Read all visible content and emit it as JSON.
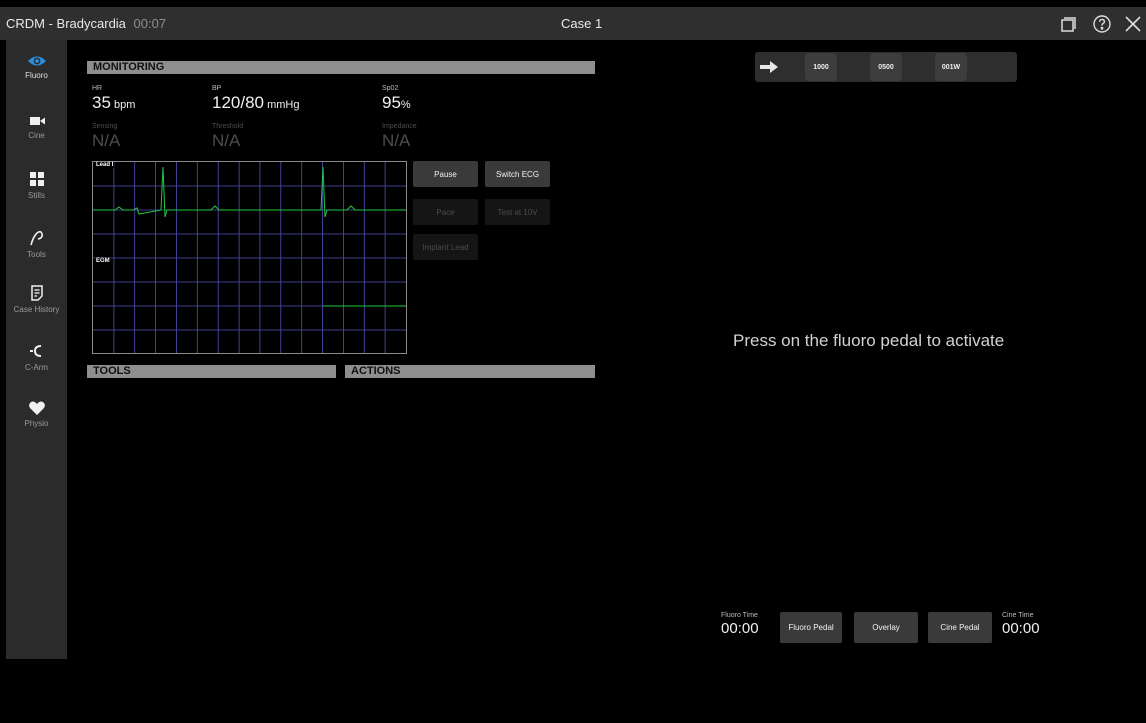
{
  "titlebar": {
    "app_title": "CRDM - Bradycardia",
    "elapsed": "00:07",
    "case_title": "Case 1",
    "icons": [
      "window-restore-icon",
      "help-icon",
      "close-icon"
    ]
  },
  "sidebar": {
    "items": [
      {
        "label": "Fluoro",
        "icon": "eye-icon",
        "active": true
      },
      {
        "label": "Cine",
        "icon": "video-camera-icon"
      },
      {
        "label": "Stills",
        "icon": "grid-icon"
      },
      {
        "label": "Tools",
        "icon": "lasso-icon"
      },
      {
        "label": "Case History",
        "icon": "notes-icon"
      },
      {
        "label": "C-Arm",
        "icon": "c-arm-icon"
      },
      {
        "label": "Physio",
        "icon": "heart-icon"
      }
    ]
  },
  "monitoring": {
    "header": "MONITORING",
    "vitals": {
      "hr": {
        "label": "HR",
        "value": "35",
        "unit": "bpm"
      },
      "bp": {
        "label": "BP",
        "value": "120/80",
        "unit": "mmHg"
      },
      "spo2": {
        "label": "Sp02",
        "value": "95",
        "unit": "%"
      },
      "sensing": {
        "label": "Sensing",
        "value": "N/A"
      },
      "threshold": {
        "label": "Threshold",
        "value": "N/A"
      },
      "impedance": {
        "label": "Impedance",
        "value": "N/A"
      }
    },
    "ecg": {
      "lead_label": "Lead I",
      "egm_label": "EGM",
      "colors": {
        "grid": "#5a5ad0",
        "trace": "#22c840"
      }
    },
    "buttons": {
      "pause": "Pause",
      "switch_ecg": "Switch ECG",
      "pace": "Pace",
      "test": "Test at 10V",
      "implant_lead": "Implant Lead"
    }
  },
  "tools": {
    "header": "TOOLS"
  },
  "actions": {
    "header": "ACTIONS"
  },
  "pacer_bar": {
    "values": [
      "1000",
      "0500",
      "001W"
    ]
  },
  "fluoro": {
    "message": "Press on the fluoro pedal to activate",
    "fluoro_time_label": "Fluoro Time",
    "fluoro_time": "00:00",
    "cine_time_label": "Cine Time",
    "cine_time": "00:00",
    "buttons": {
      "fluoro_pedal": "Fluoro Pedal",
      "overlay": "Overlay",
      "cine_pedal": "Cine Pedal"
    }
  }
}
